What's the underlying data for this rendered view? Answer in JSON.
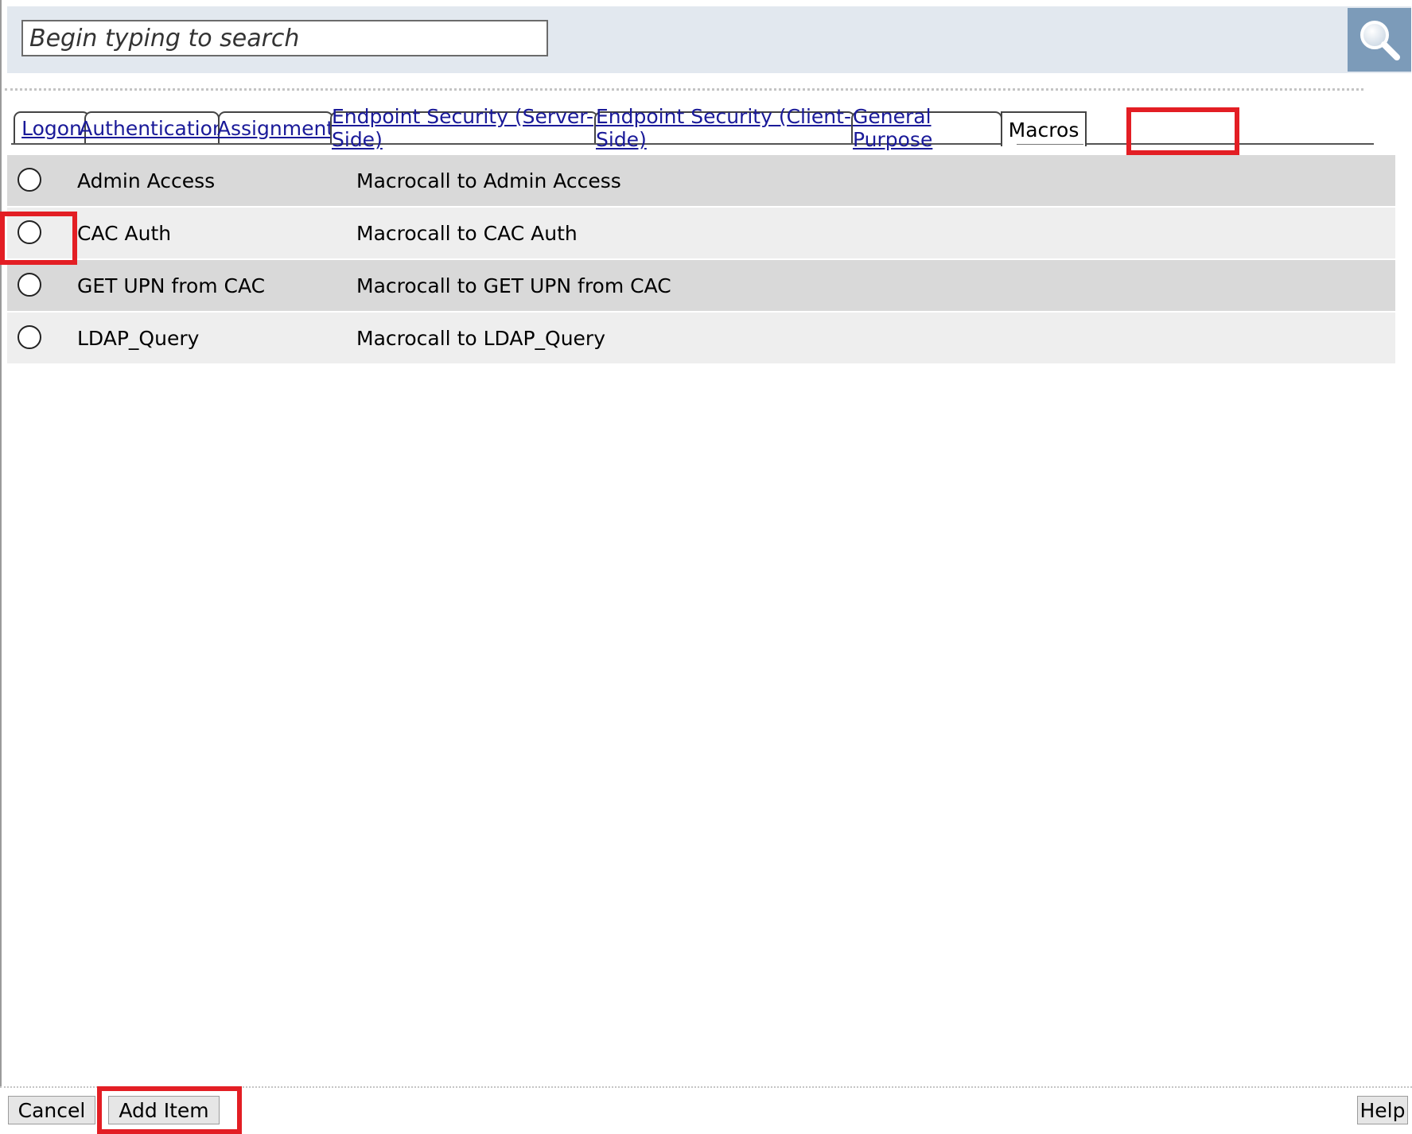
{
  "search": {
    "placeholder": "Begin typing to search",
    "value": ""
  },
  "tabs": [
    {
      "label": "Logon",
      "active": false
    },
    {
      "label": "Authentication",
      "active": false
    },
    {
      "label": "Assignment",
      "active": false
    },
    {
      "label": "Endpoint Security (Server-Side)",
      "active": false
    },
    {
      "label": "Endpoint Security (Client-Side)",
      "active": false
    },
    {
      "label": "General Purpose",
      "active": false
    },
    {
      "label": "Macros",
      "active": true
    }
  ],
  "macros": [
    {
      "name": "Admin Access",
      "description": "Macrocall to Admin Access",
      "selected": false
    },
    {
      "name": "CAC Auth",
      "description": "Macrocall to CAC Auth",
      "selected": false
    },
    {
      "name": "GET UPN from CAC",
      "description": "Macrocall to GET UPN from CAC",
      "selected": false
    },
    {
      "name": "LDAP_Query",
      "description": "Macrocall to LDAP_Query",
      "selected": false
    }
  ],
  "footer": {
    "cancel_label": "Cancel",
    "add_item_label": "Add Item",
    "help_label": "Help"
  },
  "colors": {
    "highlight": "#e31e24",
    "search_bar_bg": "#e2e8ef",
    "search_button_bg": "#7c9bb9",
    "link": "#1a1a99"
  },
  "icons": {
    "search_button": "magnifier-icon"
  }
}
